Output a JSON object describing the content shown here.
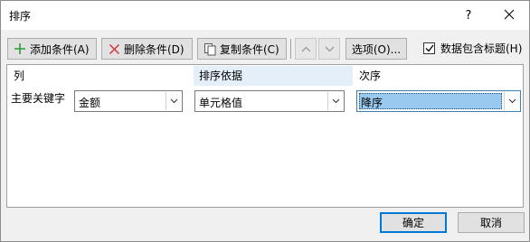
{
  "window": {
    "title": "排序",
    "help_label": "?"
  },
  "toolbar": {
    "add_label": "添加条件(A)",
    "delete_label": "删除条件(D)",
    "copy_label": "复制条件(C)",
    "options_label": "选项(O)...",
    "header_checkbox_label": "数据包含标题(H)",
    "header_checkbox_checked": true
  },
  "grid": {
    "headers": {
      "column": "列",
      "sort_on": "排序依据",
      "order": "次序"
    },
    "row": {
      "label": "主要关键字",
      "column_value": "金额",
      "sort_on_value": "单元格值",
      "order_value": "降序"
    }
  },
  "buttons": {
    "ok": "确定",
    "cancel": "取消"
  },
  "colors": {
    "accent": "#0078d7",
    "add_icon": "#2e9b3a",
    "delete_icon": "#d13438",
    "selection": "#99c9ef"
  }
}
